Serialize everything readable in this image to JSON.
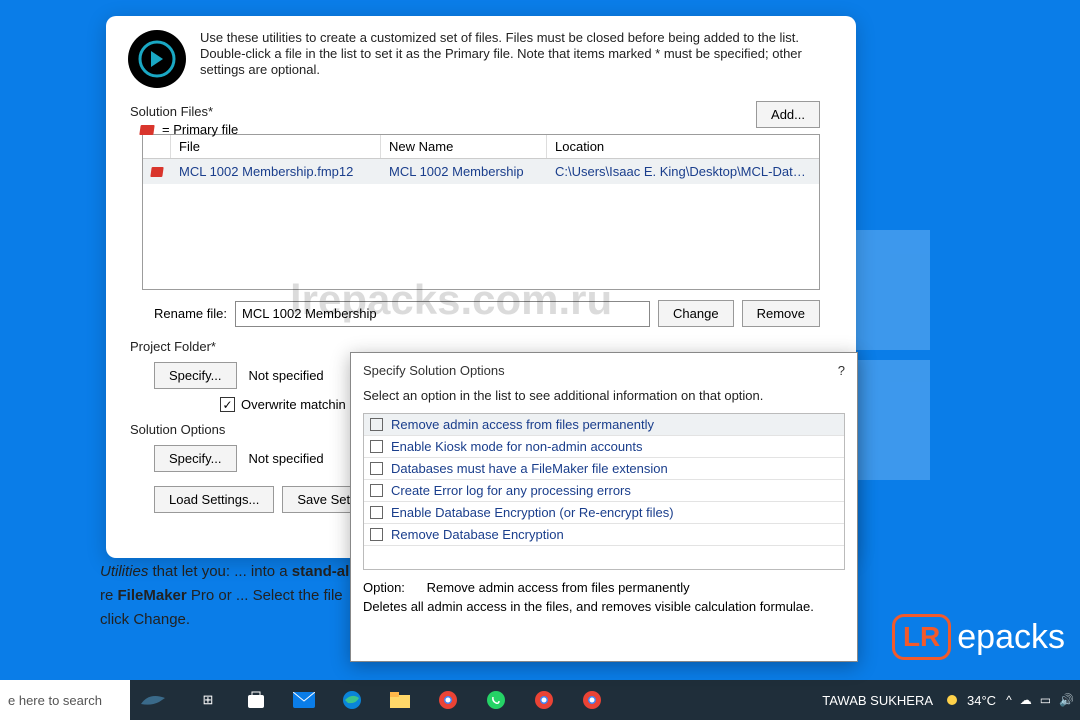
{
  "intro": "Use these utilities to create a customized set of files. Files must be closed before being added to the list. Double-click a file in the list to set it as the Primary file. Note that items marked * must be specified; other settings are optional.",
  "labels": {
    "solution_files": "Solution Files*",
    "primary_legend": "= Primary file",
    "add": "Add...",
    "rename": "Rename file:",
    "change": "Change",
    "remove": "Remove",
    "project_folder": "Project Folder*",
    "specify": "Specify...",
    "not_specified": "Not specified",
    "overwrite": "Overwrite matchin",
    "solution_options": "Solution Options",
    "load": "Load Settings...",
    "save": "Save Settings..."
  },
  "table": {
    "headers": {
      "file": "File",
      "new": "New Name",
      "loc": "Location"
    },
    "row": {
      "file": "MCL 1002 Membership.fmp12",
      "new": "MCL 1002 Membership",
      "loc": "C:\\Users\\Isaac E. King\\Desktop\\MCL-Data\\Do..."
    }
  },
  "rename_value": "MCL 1002 Membership",
  "watermark": "lrepacks.com.ru",
  "modal": {
    "title": "Specify Solution Options",
    "help": "?",
    "desc": "Select an option in the list to see additional information on that option.",
    "options": [
      "Remove admin access from files permanently",
      "Enable Kiosk mode for non-admin accounts",
      "Databases must have a FileMaker file extension",
      "Create Error log for any processing errors",
      "Enable Database Encryption (or Re-encrypt files)",
      "Remove Database Encryption"
    ],
    "footer_label": "Option:",
    "footer_value": "Remove admin access from files permanently",
    "footer_desc": "Deletes all admin access in the files, and removes visible calculation formulae."
  },
  "bg": {
    "l1a": "Utilities",
    "l1b": " that let you: ... into a ",
    "l1c": "stand-al",
    "l2a": "re ",
    "l2b": "FileMaker",
    "l2c": " Pro or ... Select the file",
    "l3": "click Change."
  },
  "taskbar": {
    "search": "e here to search",
    "user": "TAWAB SUKHERA",
    "temp": "34°C"
  },
  "brand": "epacks",
  "brand_lr": "LR"
}
